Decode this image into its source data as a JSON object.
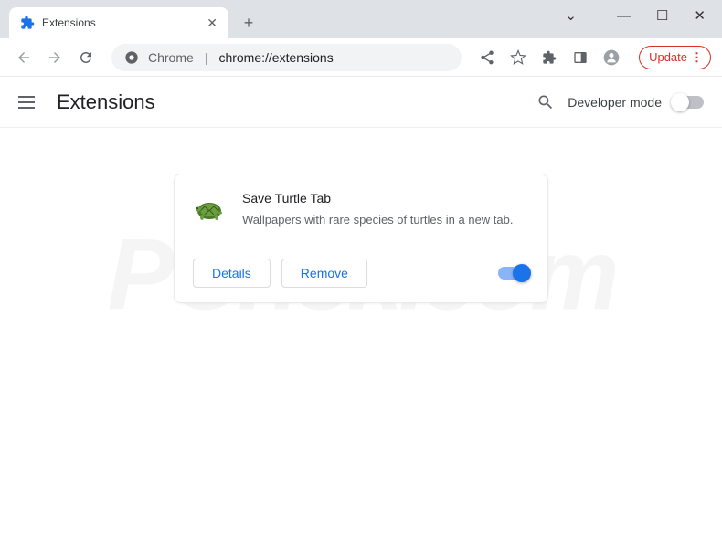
{
  "window": {
    "tab_title": "Extensions"
  },
  "toolbar": {
    "url_label": "Chrome",
    "url_path": "chrome://extensions",
    "update_label": "Update"
  },
  "header": {
    "page_title": "Extensions",
    "dev_mode_label": "Developer mode",
    "dev_mode_enabled": false
  },
  "extension": {
    "name": "Save Turtle Tab",
    "description": "Wallpapers with rare species of turtles in a new tab.",
    "details_label": "Details",
    "remove_label": "Remove",
    "enabled": true
  },
  "watermark": "PCrisk.com"
}
